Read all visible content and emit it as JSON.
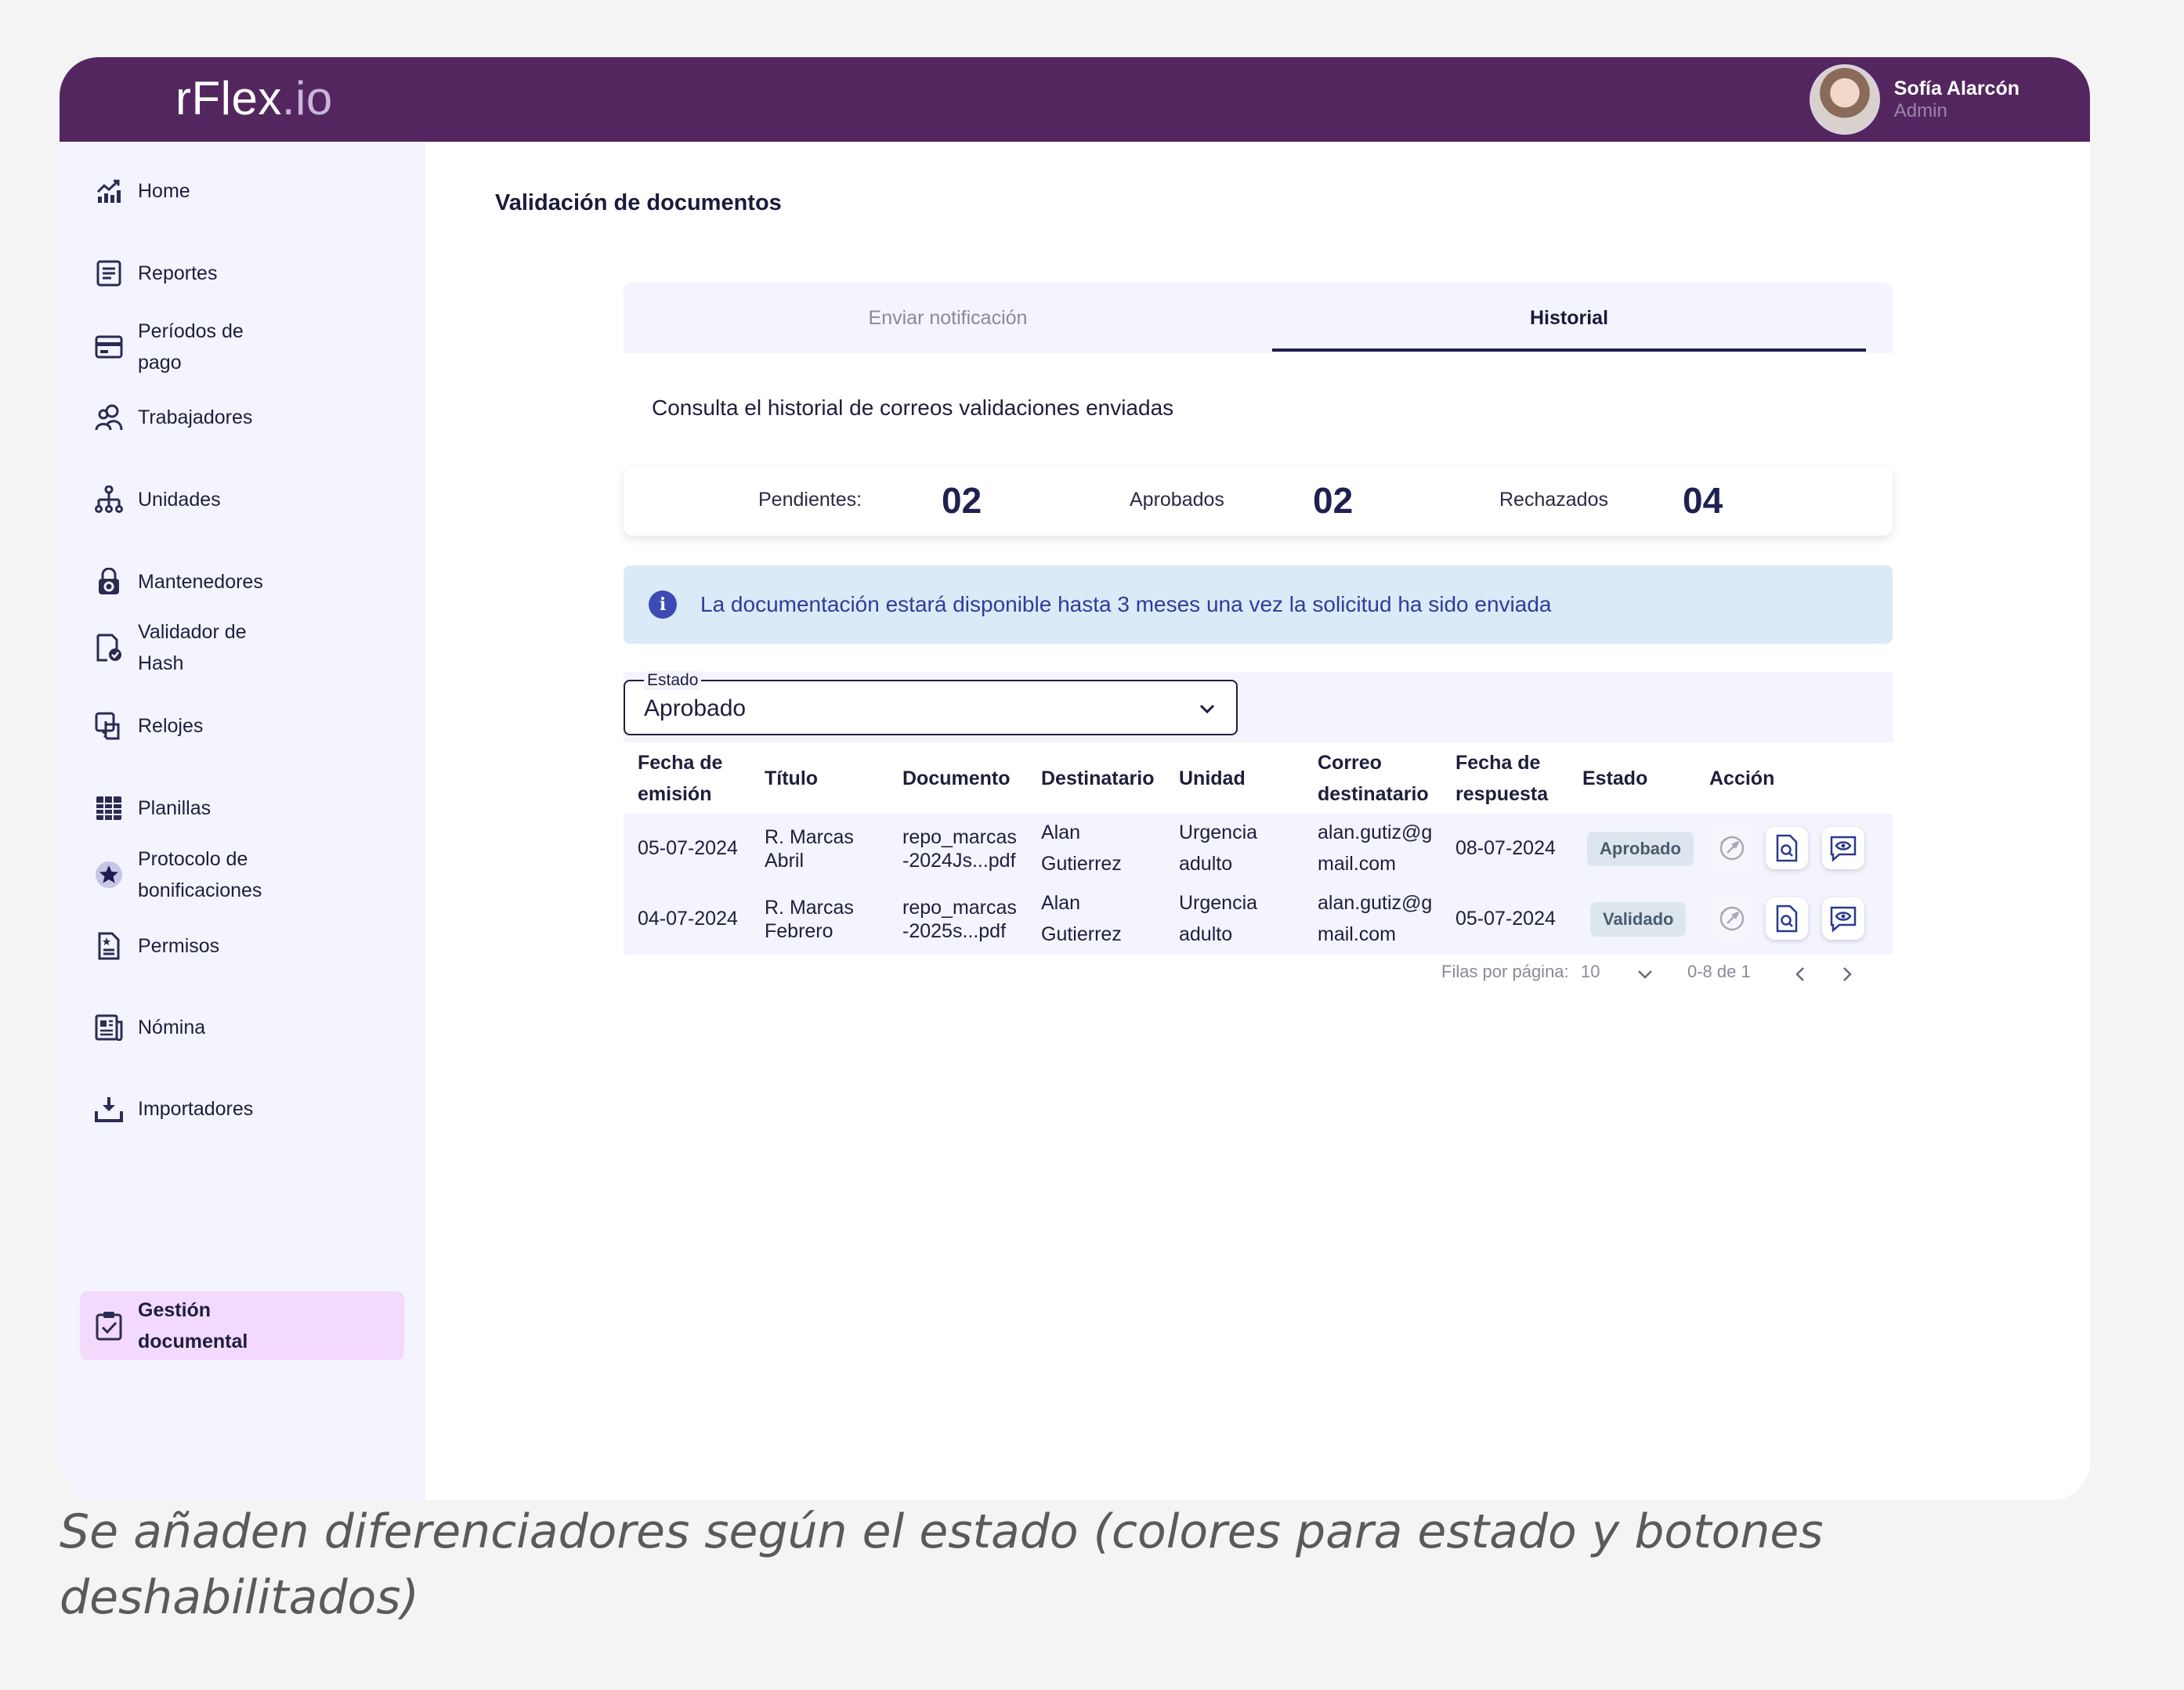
{
  "app": {
    "logo_main": "rFlex",
    "logo_suffix": ".io",
    "brand_color": "#54265f"
  },
  "user": {
    "name": "Sofía Alarcón",
    "role": "Admin"
  },
  "sidebar": {
    "items": [
      {
        "label": "Home",
        "icon": "chart-icon"
      },
      {
        "label": "Reportes",
        "icon": "report-icon"
      },
      {
        "label": "Períodos de pago",
        "icon": "calendar-card-icon"
      },
      {
        "label": "Trabajadores",
        "icon": "workers-icon"
      },
      {
        "label": "Unidades",
        "icon": "hierarchy-icon"
      },
      {
        "label": "Mantenedores",
        "icon": "lock-gear-icon"
      },
      {
        "label": "Validador de Hash",
        "icon": "doc-check-icon"
      },
      {
        "label": "Relojes",
        "icon": "touch-icon"
      },
      {
        "label": "Planillas",
        "icon": "grid-icon"
      },
      {
        "label": "Protocolo de bonificaciones",
        "icon": "star-icon"
      },
      {
        "label": "Permisos",
        "icon": "permission-doc-icon"
      },
      {
        "label": "Nómina",
        "icon": "news-icon"
      },
      {
        "label": "Importadores",
        "icon": "download-tray-icon"
      },
      {
        "label": "Gestión documental",
        "icon": "clipboard-check-icon",
        "active": true
      }
    ]
  },
  "page": {
    "title": "Validación de documentos"
  },
  "tabs": {
    "items": [
      {
        "label": "Enviar notificación",
        "active": false
      },
      {
        "label": "Historial",
        "active": true
      }
    ]
  },
  "subtitle": "Consulta el historial de correos validaciones enviadas",
  "counters": {
    "pending_label": "Pendientes:",
    "pending_value": "02",
    "approved_label": "Aprobados",
    "approved_value": "02",
    "rejected_label": "Rechazados",
    "rejected_value": "04"
  },
  "info": {
    "text": "La documentación estará disponible hasta 3 meses una vez la solicitud ha sido enviada"
  },
  "filter": {
    "legend": "Estado",
    "value": "Aprobado"
  },
  "table": {
    "headers": {
      "fecha_emision": "Fecha de emisión",
      "titulo": "Título",
      "documento": "Documento",
      "destinatario": "Destinatario",
      "unidad": "Unidad",
      "correo": "Correo destinatario",
      "fecha_respuesta": "Fecha de respuesta",
      "estado": "Estado",
      "accion": "Acción"
    },
    "rows": [
      {
        "fecha_emision": "05-07-2024",
        "titulo": "R. Marcas Abril",
        "documento": "repo_marcas -2024Js...pdf",
        "destinatario": "Alan Gutierrez",
        "unidad": "Urgencia adulto",
        "correo": "alan.gutiz@g mail.com",
        "fecha_respuesta": "08-07-2024",
        "estado": "Aprobado"
      },
      {
        "fecha_emision": "04-07-2024",
        "titulo": "R. Marcas Febrero",
        "documento": "repo_marcas -2025s...pdf",
        "destinatario": "Alan Gutierrez",
        "unidad": "Urgencia adulto",
        "correo": "alan.gutiz@g mail.com",
        "fecha_respuesta": "05-07-2024",
        "estado": "Validado"
      }
    ]
  },
  "pagination": {
    "rows_label": "Filas por página:",
    "rows_value": "10",
    "range": "0-8 de 1"
  },
  "caption": "Se añaden diferenciadores según el estado (colores para estado y botones deshabilitados)"
}
